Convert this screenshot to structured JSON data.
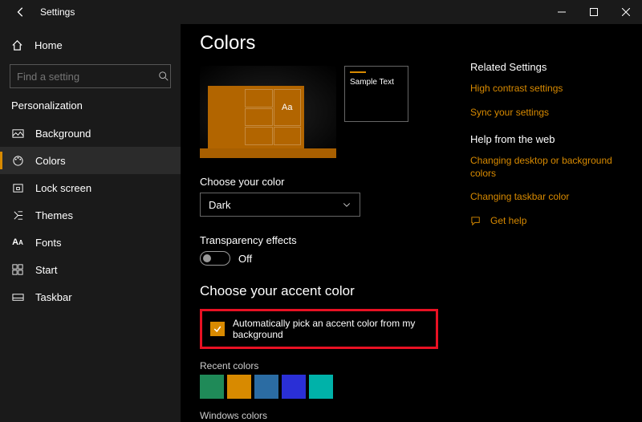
{
  "window": {
    "title": "Settings"
  },
  "sidebar": {
    "home": "Home",
    "search_placeholder": "Find a setting",
    "category": "Personalization",
    "items": [
      {
        "label": "Background"
      },
      {
        "label": "Colors"
      },
      {
        "label": "Lock screen"
      },
      {
        "label": "Themes"
      },
      {
        "label": "Fonts"
      },
      {
        "label": "Start"
      },
      {
        "label": "Taskbar"
      }
    ]
  },
  "page": {
    "title": "Colors",
    "preview_text": "Sample Text",
    "preview_aa": "Aa",
    "choose_color_label": "Choose your color",
    "choose_color_value": "Dark",
    "transparency_label": "Transparency effects",
    "transparency_state": "Off",
    "accent_heading": "Choose your accent color",
    "auto_pick_label": "Automatically pick an accent color from my background",
    "recent_colors_label": "Recent colors",
    "recent_colors": [
      "#1f8a58",
      "#d88a00",
      "#2b6ca3",
      "#2a2fd6",
      "#00b2a9"
    ],
    "windows_colors_label": "Windows colors"
  },
  "aside": {
    "related_heading": "Related Settings",
    "links": [
      "High contrast settings",
      "Sync your settings"
    ],
    "help_heading": "Help from the web",
    "help_links": [
      "Changing desktop or background colors",
      "Changing taskbar color"
    ],
    "get_help": "Get help"
  }
}
